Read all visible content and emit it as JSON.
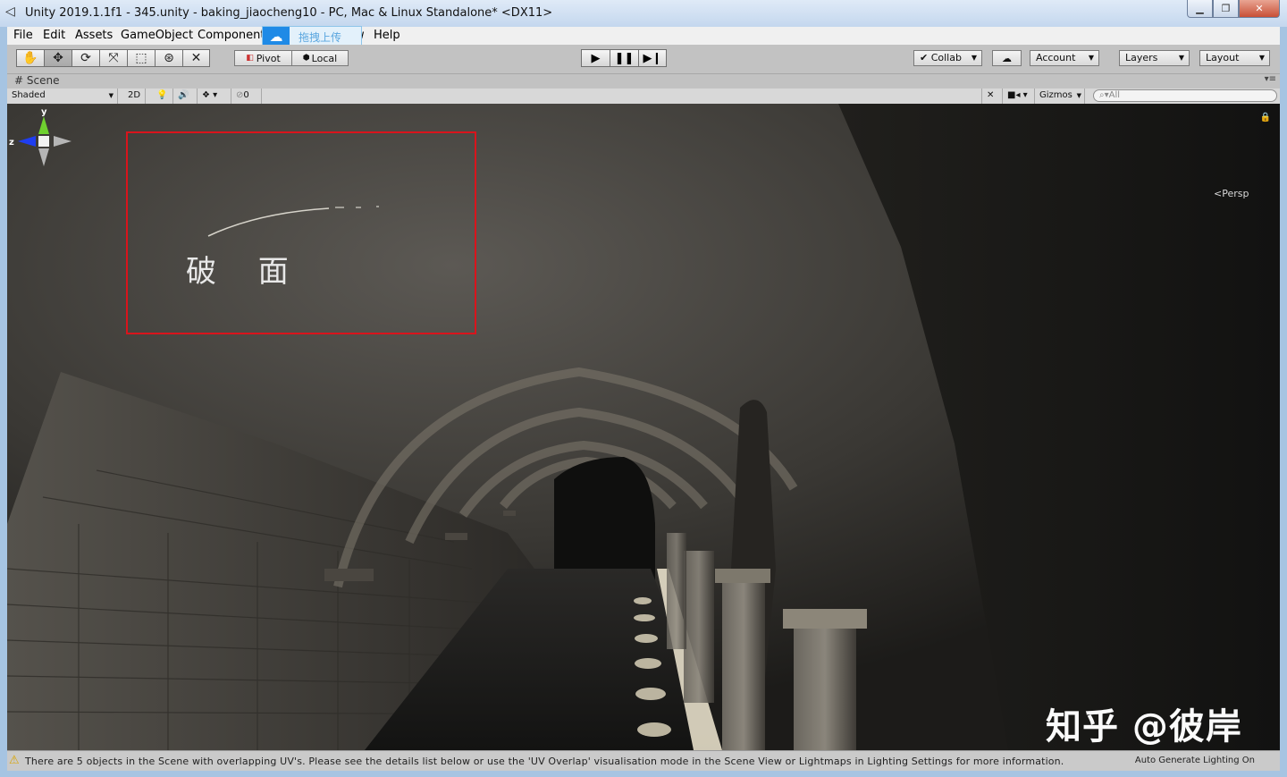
{
  "window": {
    "title": "Unity 2019.1.1f1 - 345.unity - baking_jiaocheng10 - PC, Mac & Linux Standalone* <DX11>",
    "app_icon": "unity-logo-icon",
    "minimize": "▁",
    "maximize": "❐",
    "close": "✕"
  },
  "menu": {
    "file": "File",
    "edit": "Edit",
    "assets": "Assets",
    "gameobject": "GameObject",
    "component": "Component",
    "window_partial": "w",
    "help": "Help"
  },
  "upload_popup": {
    "label": "拖拽上传",
    "icon": "baidu-cloud-icon"
  },
  "toolbar": {
    "tools": [
      "hand-tool",
      "move-tool",
      "rotate-tool",
      "scale-tool",
      "rect-tool",
      "transform-tool",
      "custom-tool"
    ],
    "pivot": "Pivot",
    "local": "Local",
    "collab": "Collab",
    "account": "Account",
    "layers": "Layers",
    "layout": "Layout"
  },
  "scene_tab": {
    "label": "Scene"
  },
  "scene_bar": {
    "shading": "Shaded",
    "mode_2d": "2D",
    "hidden_count": "0",
    "gizmos": "Gizmos",
    "search_placeholder": "All"
  },
  "viewport": {
    "annotation": "破 面",
    "gizmo_y": "y",
    "gizmo_z": "z",
    "projection": "Persp",
    "watermark": "知乎 @彼岸"
  },
  "status": {
    "message": "There are 5 objects in the Scene with overlapping UV's. Please see the details list below or use the 'UV Overlap' visualisation mode in the Scene View or Lightmaps in Lighting Settings for more information.",
    "right": "Auto Generate Lighting On"
  },
  "colors": {
    "annotation_border": "#d9141c",
    "gizmo_y": "#6fd12f",
    "gizmo_z": "#1f3ef0"
  }
}
